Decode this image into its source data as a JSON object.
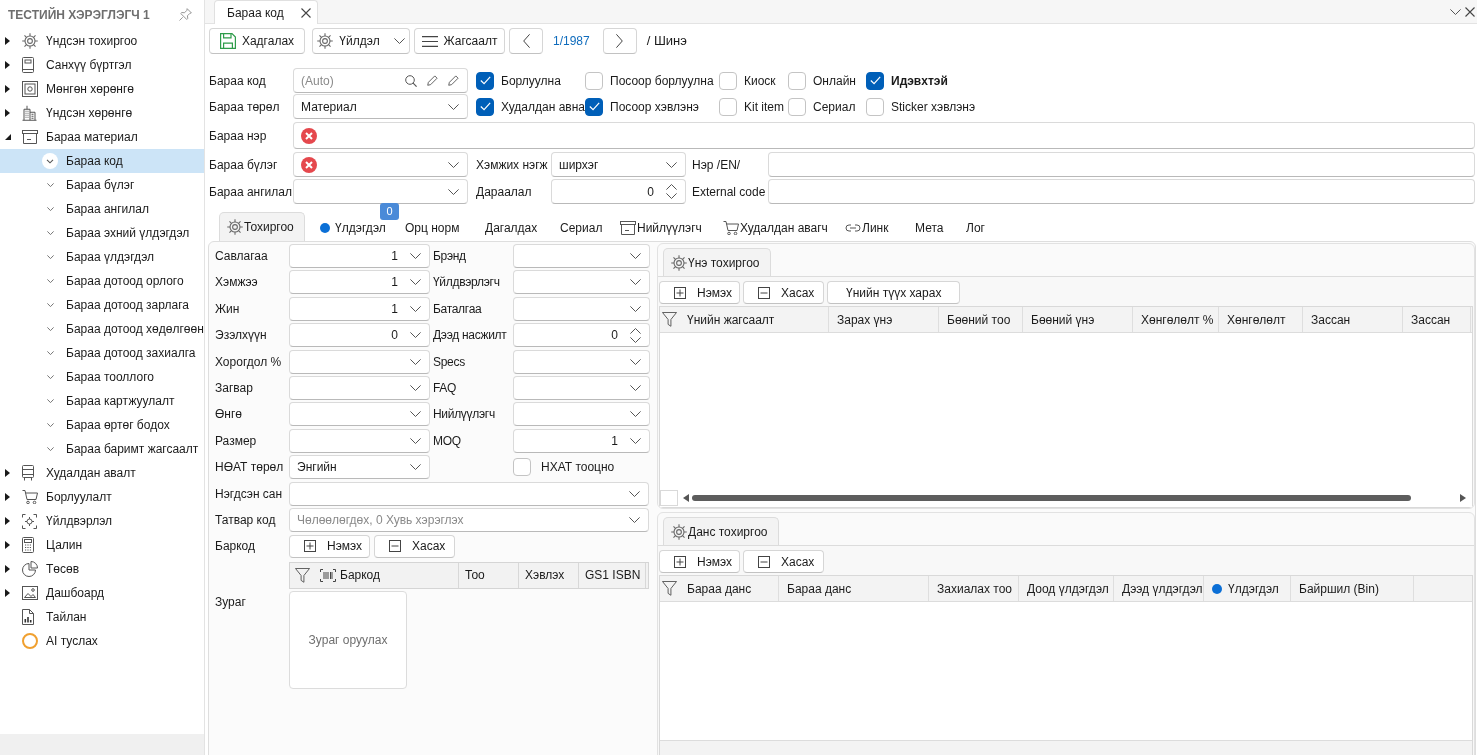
{
  "sidebar": {
    "title": "ТЕСТИЙН ХЭРЭГЛЭГЧ 1",
    "items": [
      {
        "label": "Үндсэн тохиргоо",
        "kind": "folder",
        "expanded": false,
        "selected": false
      },
      {
        "label": "Санхүү бүртгэл",
        "kind": "folder",
        "expanded": false,
        "selected": false
      },
      {
        "label": "Мөнгөн хөрөнгө",
        "kind": "folder",
        "expanded": false,
        "selected": false
      },
      {
        "label": "Үндсэн хөрөнгө",
        "kind": "folder",
        "expanded": false,
        "selected": false
      },
      {
        "label": "Бараа материал",
        "kind": "folder",
        "expanded": true,
        "selected": false,
        "children": [
          {
            "label": "Бараа код",
            "selected": true
          },
          {
            "label": "Бараа бүлэг",
            "selected": false
          },
          {
            "label": "Бараа ангилал",
            "selected": false
          },
          {
            "label": "Бараа эхний үлдэгдэл",
            "selected": false
          },
          {
            "label": "Бараа үлдэгдэл",
            "selected": false
          },
          {
            "label": "Бараа дотоод орлого",
            "selected": false
          },
          {
            "label": "Бараа дотоод зарлага",
            "selected": false
          },
          {
            "label": "Бараа дотоод хөдөлгөөн",
            "selected": false
          },
          {
            "label": "Бараа дотоод захиалга",
            "selected": false
          },
          {
            "label": "Бараа тооллого",
            "selected": false
          },
          {
            "label": "Бараа картжуулалт",
            "selected": false
          },
          {
            "label": "Бараа өртөг бодох",
            "selected": false
          },
          {
            "label": "Бараа баримт жагсаалт",
            "selected": false
          }
        ]
      },
      {
        "label": "Худалдан авалт",
        "kind": "folder",
        "expanded": false,
        "selected": false
      },
      {
        "label": "Борлуулалт",
        "kind": "folder",
        "expanded": false,
        "selected": false
      },
      {
        "label": "Үйлдвэрлэл",
        "kind": "folder",
        "expanded": false,
        "selected": false
      },
      {
        "label": "Цалин",
        "kind": "folder",
        "expanded": false,
        "selected": false
      },
      {
        "label": "Төсөв",
        "kind": "folder",
        "expanded": false,
        "selected": false
      },
      {
        "label": "Дашбоард",
        "kind": "folder",
        "expanded": false,
        "selected": false
      },
      {
        "label": "Тайлан",
        "kind": "link",
        "expanded": false,
        "selected": false
      },
      {
        "label": "AI туслах",
        "kind": "link",
        "expanded": false,
        "selected": false
      }
    ]
  },
  "document_tabs": [
    {
      "label": "Бараа код",
      "selected": true
    }
  ],
  "toolbar": {
    "buttons": [
      {
        "kind": "save",
        "label": "Хадгалах"
      },
      {
        "kind": "dropdown",
        "label": "Үйлдэл"
      },
      {
        "kind": "list",
        "label": "Жагсаалт"
      }
    ],
    "record_position": "1/1987",
    "record_state": "/ Шинэ"
  },
  "item_form": {
    "rows": [
      {
        "label": "Бараа код",
        "field": {
          "kind": "search",
          "placeholder": "(Auto)",
          "invalid": false
        },
        "flags": [
          {
            "label": "Борлуулна",
            "checked": true
          },
          {
            "label": "Посоор борлуулна",
            "checked": false
          },
          {
            "label": "Киоск",
            "checked": false
          },
          {
            "label": "Онлайн",
            "checked": false
          },
          {
            "label": "Идэвхтэй",
            "checked": true
          }
        ]
      },
      {
        "label": "Бараа төрөл",
        "field": {
          "kind": "select",
          "value": "Материал",
          "invalid": false
        },
        "flags": [
          {
            "label": "Худалдан авна",
            "checked": true
          },
          {
            "label": "Посоор хэвлэнэ",
            "checked": true
          },
          {
            "label": "Kit item",
            "checked": false
          },
          {
            "label": "Сериал",
            "checked": false
          },
          {
            "label": "Sticker хэвлэнэ",
            "checked": false
          }
        ]
      },
      {
        "label": "Бараа нэр",
        "field": {
          "kind": "text",
          "invalid": true
        }
      },
      {
        "label": "Бараа бүлэг",
        "field": {
          "kind": "select",
          "invalid": true
        },
        "extra": [
          {
            "label": "Хэмжих нэгж",
            "field": {
              "kind": "select",
              "value": "ширхэг"
            }
          },
          {
            "label": "Нэр /EN/",
            "field": {
              "kind": "text"
            }
          }
        ]
      },
      {
        "label": "Бараа ангилал",
        "field": {
          "kind": "select",
          "invalid": false
        },
        "extra": [
          {
            "label": "Дараалал",
            "field": {
              "kind": "spin",
              "value": "0"
            }
          },
          {
            "label": "External code",
            "field": {
              "kind": "text"
            }
          }
        ]
      }
    ]
  },
  "detail_tabs": [
    {
      "label": "Тохиргоо",
      "selected": true
    },
    {
      "label": "Үлдэгдэл",
      "selected": false,
      "badge": "0"
    },
    {
      "label": "Орц норм",
      "selected": false
    },
    {
      "label": "Дагалдах",
      "selected": false
    },
    {
      "label": "Сериал",
      "selected": false
    },
    {
      "label": "Нийлүүлэгч",
      "selected": false
    },
    {
      "label": "Худалдан авагч",
      "selected": false
    },
    {
      "label": "Линк",
      "selected": false
    },
    {
      "label": "Мета",
      "selected": false
    },
    {
      "label": "Лог",
      "selected": false
    }
  ],
  "settings": {
    "left": [
      {
        "label": "Савлагаа",
        "kind": "numeric",
        "value": "1"
      },
      {
        "label": "Хэмжээ",
        "kind": "numeric",
        "value": "1"
      },
      {
        "label": "Жин",
        "kind": "numeric",
        "value": "1"
      },
      {
        "label": "Эзэлхүүн",
        "kind": "numeric",
        "value": "0"
      },
      {
        "label": "Хорогдол %",
        "kind": "select"
      },
      {
        "label": "Загвар",
        "kind": "select"
      },
      {
        "label": "Өнгө",
        "kind": "select"
      },
      {
        "label": "Размер",
        "kind": "select"
      },
      {
        "label": "НӨАТ төрөл",
        "kind": "select",
        "value": "Энгийн"
      }
    ],
    "right": [
      {
        "label": "Брэнд",
        "kind": "select"
      },
      {
        "label": "Үйлдвэрлэгч",
        "kind": "select"
      },
      {
        "label": "Баталгаа",
        "kind": "select"
      },
      {
        "label": "Дээд насжилт",
        "kind": "spin",
        "value": "0"
      },
      {
        "label": "Specs",
        "kind": "select"
      },
      {
        "label": "FAQ",
        "kind": "select"
      },
      {
        "label": "Нийлүүлэгч",
        "kind": "select"
      },
      {
        "label": "MOQ",
        "kind": "numeric",
        "value": "1"
      },
      {
        "label": "НХАТ тооцно",
        "kind": "checkbox",
        "checked": false
      }
    ],
    "wide": [
      {
        "label": "Нэгдсэн сан",
        "kind": "select"
      },
      {
        "label": "Татвар код",
        "kind": "select",
        "placeholder": "Чөлөөлөгдөх, 0 Хувь хэрэглэх"
      }
    ],
    "barcode": {
      "label": "Баркод",
      "buttons": [
        {
          "kind": "add",
          "label": "Нэмэх"
        },
        {
          "kind": "remove",
          "label": "Хасах"
        }
      ],
      "columns": [
        "Баркод",
        "Тоо",
        "Хэвлэх",
        "GS1 ISBN"
      ]
    },
    "picture": {
      "label": "Зураг",
      "placeholder": "Зураг оруулах"
    }
  },
  "price_settings": {
    "title": "Үнэ тохиргоо",
    "buttons": [
      {
        "kind": "add",
        "label": "Нэмэх"
      },
      {
        "kind": "remove",
        "label": "Хасах"
      },
      {
        "kind": "plain",
        "label": "Үнийн түүх харах"
      }
    ],
    "columns": [
      "Үнийн жагсаалт",
      "Зарах үнэ",
      "Бөөний тоо",
      "Бөөний үнэ",
      "Хөнгөлөлт %",
      "Хөнгөлөлт",
      "Зассан",
      "Зассан"
    ]
  },
  "account_settings": {
    "title": "Данс тохиргоо",
    "buttons": [
      {
        "kind": "add",
        "label": "Нэмэх"
      },
      {
        "kind": "remove",
        "label": "Хасах"
      }
    ],
    "columns": [
      {
        "label": "Бараа данс",
        "kind": "text"
      },
      {
        "label": "Бараа данс",
        "kind": "text"
      },
      {
        "label": "Захиалах тоо",
        "kind": "text"
      },
      {
        "label": "Доод үлдэгдэл",
        "kind": "text"
      },
      {
        "label": "Дээд үлдэгдэл",
        "kind": "text"
      },
      {
        "label": "Үлдэгдэл",
        "kind": "status"
      },
      {
        "label": "Байршил (Bin)",
        "kind": "text"
      }
    ]
  }
}
